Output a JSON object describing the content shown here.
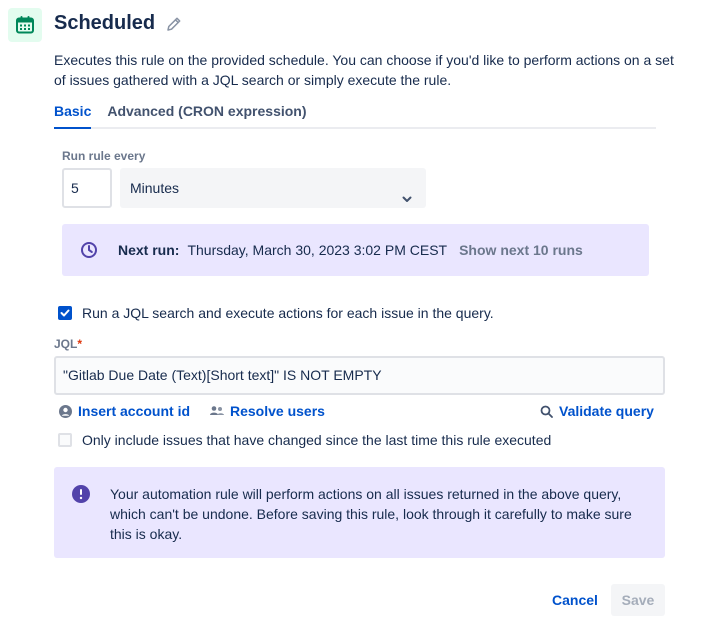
{
  "header": {
    "title": "Scheduled",
    "icon": "calendar-icon",
    "icon_color": "#00875a",
    "icon_bg": "#e3fcef"
  },
  "description": "Executes this rule on the provided schedule. You can choose if you'd like to perform actions on a set of issues gathered with a JQL search or simply execute the rule.",
  "tabs": [
    {
      "label": "Basic",
      "active": true
    },
    {
      "label": "Advanced (CRON expression)",
      "active": false
    }
  ],
  "schedule": {
    "label": "Run rule every",
    "interval_value": "5",
    "unit_value": "Minutes"
  },
  "next_run": {
    "label": "Next run:",
    "value": "Thursday, March 30, 2023 3:02 PM CEST",
    "show_next": "Show next 10 runs"
  },
  "jql_option": {
    "label": "Run a JQL search and execute actions for each issue in the query.",
    "checked": true
  },
  "jql": {
    "label": "JQL",
    "required_marker": "*",
    "value": "\"Gitlab Due Date (Text)[Short text]\" IS NOT EMPTY",
    "insert_account_id": "Insert account id",
    "resolve_users": "Resolve users",
    "validate_query": "Validate query"
  },
  "changed_only": {
    "label": "Only include issues that have changed since the last time this rule executed",
    "checked": false
  },
  "info": {
    "text": "Your automation rule will perform actions on all issues returned in the above query, which can't be undone. Before saving this rule, look through it carefully to make sure this is okay."
  },
  "footer": {
    "cancel": "Cancel",
    "save": "Save"
  },
  "colors": {
    "accent": "#0052cc",
    "purple": "#5243aa",
    "panel_bg": "#eae6ff"
  }
}
